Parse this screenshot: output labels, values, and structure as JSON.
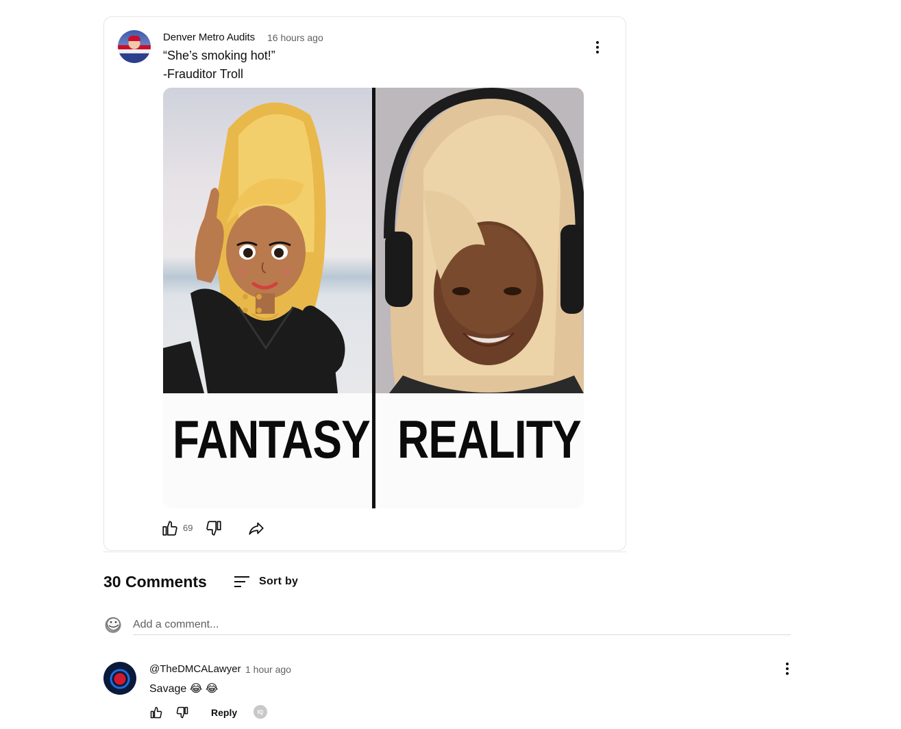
{
  "post": {
    "author": "Denver Metro Audits",
    "time": "16 hours ago",
    "text_line1": "“She’s smoking hot!”",
    "text_line2": "-Frauditor Troll",
    "image": {
      "left_caption": "FANTASY",
      "right_caption": "REALITY"
    },
    "like_count": "69",
    "icons": {
      "menu": "more-vert-icon",
      "like": "thumb-up-icon",
      "dislike": "thumb-down-icon",
      "share": "share-icon"
    }
  },
  "comments_section": {
    "title": "30 Comments",
    "sort_label": "Sort by",
    "add_comment_placeholder": "Add a comment...",
    "items": [
      {
        "author": "@TheDMCALawyer",
        "time": "1 hour ago",
        "text": "Savage 😂 😂",
        "reply_label": "Reply",
        "badge": "IQ"
      }
    ]
  },
  "colors": {
    "text_primary": "#0f0f0f",
    "text_secondary": "#606060",
    "border": "#e5e5e5"
  }
}
